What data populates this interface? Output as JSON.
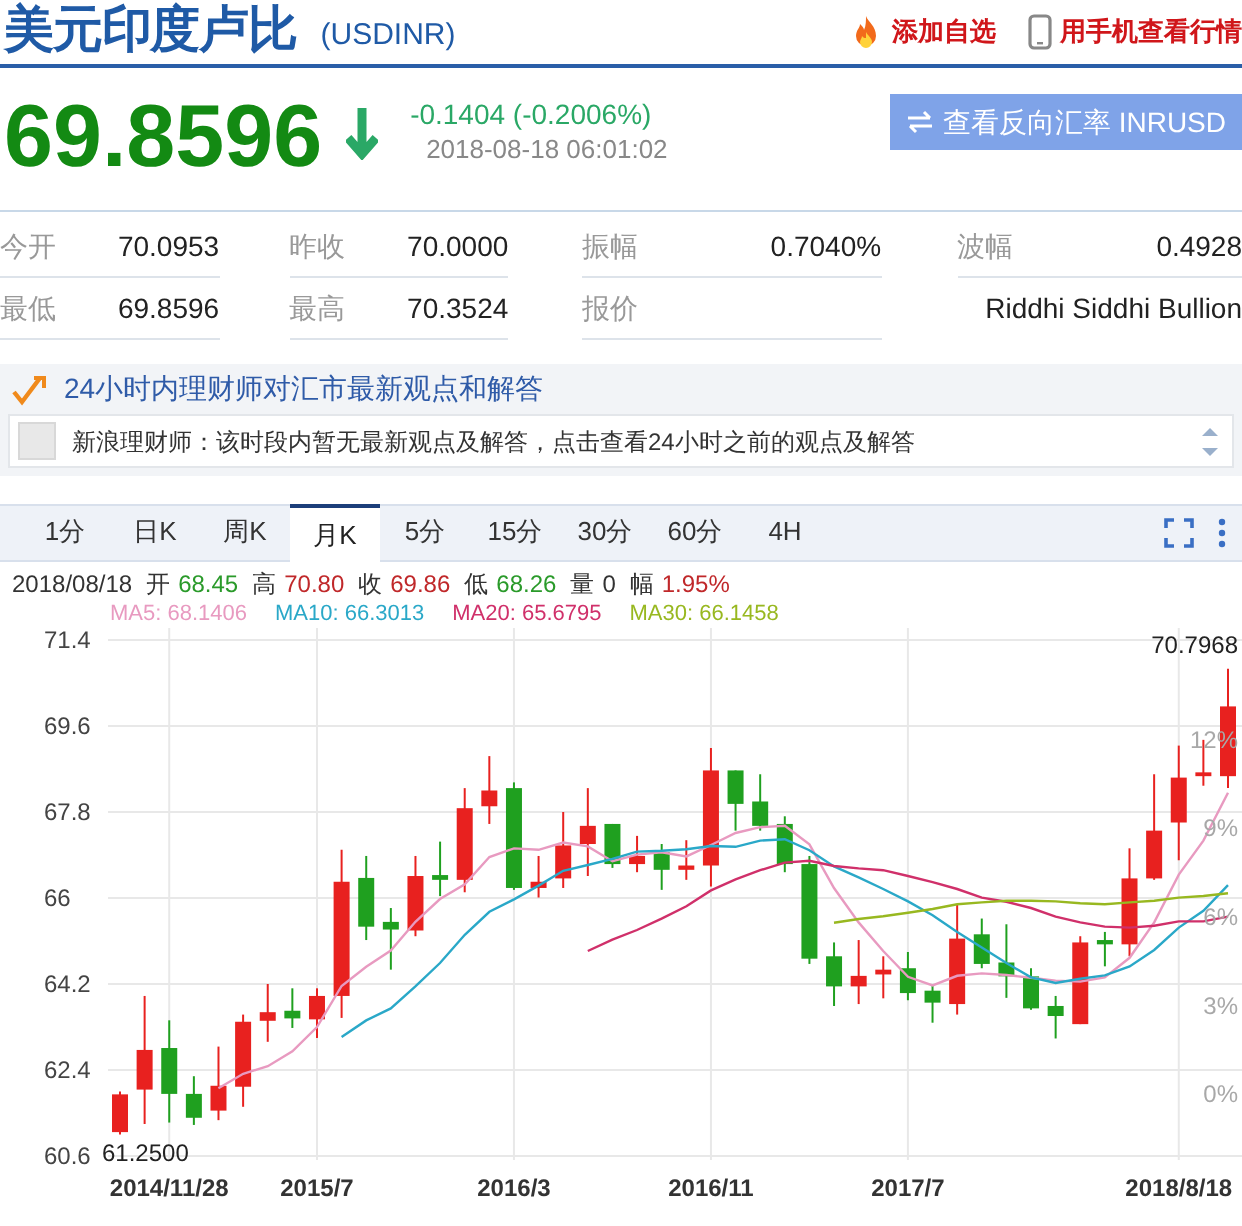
{
  "header": {
    "title": "美元印度卢比",
    "code": "(USDINR)",
    "actions": [
      {
        "kind": "favorite",
        "label": "添加自选"
      },
      {
        "kind": "mobile",
        "label": "用手机查看行情"
      }
    ]
  },
  "quote": {
    "price": "69.8596",
    "change": "-0.1404 (-0.2006%)",
    "time": "2018-08-18 06:01:02",
    "reverse_button": "查看反向汇率 INRUSD"
  },
  "stats": [
    [
      {
        "label": "今开",
        "value": "70.0953"
      },
      {
        "label": "昨收",
        "value": "70.0000"
      },
      {
        "label": "振幅",
        "value": "0.7040%"
      },
      {
        "label": "波幅",
        "value": "0.4928"
      }
    ],
    [
      {
        "label": "最低",
        "value": "69.8596"
      },
      {
        "label": "最高",
        "value": "70.3524"
      },
      {
        "label": "报价"
      },
      {
        "value": "Riddhi Siddhi Bullion"
      }
    ]
  ],
  "advice": {
    "title": "24小时内理财师对汇市最新观点和解答",
    "message": "新浪理财师：该时段内暂无最新观点及解答，点击查看24小时之前的观点及解答"
  },
  "tabs": [
    {
      "label": "1分",
      "selected": false
    },
    {
      "label": "日K",
      "selected": false
    },
    {
      "label": "周K",
      "selected": false
    },
    {
      "label": "月K",
      "selected": true
    },
    {
      "label": "5分",
      "selected": false
    },
    {
      "label": "15分",
      "selected": false
    },
    {
      "label": "30分",
      "selected": false
    },
    {
      "label": "60分",
      "selected": false
    },
    {
      "label": "4H",
      "selected": false
    }
  ],
  "summary": [
    {
      "kind": "date",
      "text": "2018/08/18"
    },
    {
      "kind": "label",
      "text": "开"
    },
    {
      "kind": "down",
      "text": "68.45"
    },
    {
      "kind": "label",
      "text": "高"
    },
    {
      "kind": "up",
      "text": "70.80"
    },
    {
      "kind": "label",
      "text": "收"
    },
    {
      "kind": "up",
      "text": "69.86"
    },
    {
      "kind": "label",
      "text": "低"
    },
    {
      "kind": "down",
      "text": "68.26"
    },
    {
      "kind": "label",
      "text": "量"
    },
    {
      "kind": "date",
      "text": "0"
    },
    {
      "kind": "label",
      "text": "幅"
    },
    {
      "kind": "up",
      "text": "1.95%"
    }
  ],
  "moving_average_values": [
    "68.1406",
    "66.3013",
    "65.6795",
    "66.1458"
  ],
  "percent_axis": [
    "12%",
    "9%",
    "6%",
    "3%",
    "0%"
  ],
  "chart_data": {
    "type": "candlestick",
    "grid": true,
    "ylim": [
      60.6,
      71.4
    ],
    "yticks": [
      71.4,
      69.6,
      67.8,
      66,
      64.2,
      62.4,
      60.6
    ],
    "categories": [
      null,
      null,
      "2014/11/28",
      null,
      null,
      null,
      null,
      null,
      "2015/7",
      null,
      null,
      null,
      null,
      null,
      null,
      null,
      "2016/3",
      null,
      null,
      null,
      null,
      null,
      null,
      null,
      "2016/11",
      null,
      null,
      null,
      null,
      null,
      null,
      null,
      "2017/7",
      null,
      null,
      null,
      null,
      null,
      null,
      null,
      null,
      null,
      null,
      "2018/8/18",
      null,
      null
    ],
    "series": [
      {
        "name": "MA5:",
        "type": "line",
        "color": "#e89ac0",
        "values": [
          null,
          null,
          null,
          null,
          62.02,
          62.32,
          62.48,
          62.79,
          63.3,
          64.16,
          64.56,
          64.9,
          65.5,
          65.98,
          66.29,
          66.86,
          67.04,
          67.01,
          67.16,
          67.08,
          66.77,
          66.91,
          66.96,
          66.87,
          67.11,
          67.36,
          67.48,
          67.51,
          67.12,
          66.21,
          65.49,
          64.89,
          64.35,
          64.17,
          64.37,
          64.42,
          64.39,
          64.33,
          64.27,
          64.25,
          64.34,
          64.75,
          65.49,
          66.49,
          67.2,
          68.2
        ]
      },
      {
        "name": "MA10:",
        "type": "line",
        "color": "#2aa8c8",
        "values": [
          null,
          null,
          null,
          null,
          null,
          null,
          null,
          null,
          null,
          63.09,
          63.44,
          63.69,
          64.15,
          64.64,
          65.23,
          65.71,
          65.97,
          66.26,
          66.57,
          66.69,
          66.82,
          66.97,
          66.99,
          67.02,
          67.09,
          67.07,
          67.2,
          67.23,
          67.0,
          66.66,
          66.43,
          66.19,
          65.93,
          65.64,
          65.29,
          64.96,
          64.64,
          64.34,
          64.22,
          64.31,
          64.38,
          64.57,
          64.91,
          65.38,
          65.73,
          66.27
        ]
      },
      {
        "name": "MA20:",
        "type": "line",
        "color": "#d0306a",
        "values": [
          null,
          null,
          null,
          null,
          null,
          null,
          null,
          null,
          null,
          null,
          null,
          null,
          null,
          null,
          null,
          null,
          null,
          null,
          null,
          64.89,
          65.13,
          65.33,
          65.57,
          65.83,
          66.16,
          66.39,
          66.58,
          66.74,
          66.78,
          66.67,
          66.62,
          66.58,
          66.46,
          66.33,
          66.19,
          66.01,
          65.92,
          65.79,
          65.61,
          65.49,
          65.4,
          65.38,
          65.42,
          65.51,
          65.51,
          65.61
        ]
      },
      {
        "name": "MA30:",
        "type": "line",
        "color": "#98b820",
        "values": [
          null,
          null,
          null,
          null,
          null,
          null,
          null,
          null,
          null,
          null,
          null,
          null,
          null,
          null,
          null,
          null,
          null,
          null,
          null,
          null,
          null,
          null,
          null,
          null,
          null,
          null,
          null,
          null,
          null,
          65.48,
          65.56,
          65.62,
          65.69,
          65.77,
          65.87,
          65.91,
          65.94,
          65.94,
          65.93,
          65.89,
          65.87,
          65.91,
          65.94,
          66.01,
          66.04,
          66.1
        ]
      }
    ],
    "annotations": [
      "70.7968",
      "61.2500"
    ],
    "ohlc": [
      [
        61.1,
        61.95,
        61.05,
        61.89
      ],
      [
        61.99,
        63.95,
        61.27,
        62.82
      ],
      [
        62.86,
        63.44,
        61.3,
        61.9
      ],
      [
        61.9,
        62.27,
        61.25,
        61.4
      ],
      [
        61.55,
        62.89,
        61.35,
        62.07
      ],
      [
        62.05,
        63.56,
        61.63,
        63.41
      ],
      [
        63.43,
        64.2,
        62.99,
        63.61
      ],
      [
        63.64,
        64.11,
        63.28,
        63.48
      ],
      [
        63.46,
        64.11,
        63.07,
        63.95
      ],
      [
        63.95,
        67.01,
        63.49,
        66.34
      ],
      [
        66.42,
        66.88,
        65.12,
        65.4
      ],
      [
        65.5,
        65.79,
        64.5,
        65.34
      ],
      [
        65.32,
        66.88,
        65.2,
        66.46
      ],
      [
        66.48,
        67.18,
        66.04,
        66.38
      ],
      [
        66.38,
        68.3,
        66.12,
        67.88
      ],
      [
        67.92,
        68.97,
        67.55,
        68.25
      ],
      [
        68.3,
        68.42,
        66.17,
        66.21
      ],
      [
        66.21,
        66.88,
        66.01,
        66.34
      ],
      [
        66.41,
        67.8,
        66.21,
        67.1
      ],
      [
        67.13,
        68.3,
        66.46,
        67.51
      ],
      [
        67.55,
        67.55,
        66.63,
        66.71
      ],
      [
        66.71,
        67.3,
        66.54,
        66.88
      ],
      [
        66.96,
        67.13,
        66.17,
        66.59
      ],
      [
        66.59,
        67.21,
        66.38,
        66.68
      ],
      [
        66.68,
        69.14,
        66.24,
        68.67
      ],
      [
        68.67,
        68.67,
        67.41,
        67.97
      ],
      [
        68.02,
        68.59,
        67.41,
        67.51
      ],
      [
        67.55,
        67.71,
        66.54,
        66.71
      ],
      [
        66.71,
        66.88,
        64.62,
        64.73
      ],
      [
        64.78,
        65.07,
        63.74,
        64.15
      ],
      [
        64.15,
        65.12,
        63.78,
        64.37
      ],
      [
        64.4,
        64.78,
        63.9,
        64.5
      ],
      [
        64.53,
        64.87,
        63.86,
        64.01
      ],
      [
        64.06,
        64.2,
        63.39,
        63.81
      ],
      [
        63.78,
        65.87,
        63.56,
        65.15
      ],
      [
        65.24,
        65.57,
        64.53,
        64.62
      ],
      [
        64.65,
        65.45,
        63.91,
        64.36
      ],
      [
        64.36,
        64.53,
        63.66,
        63.69
      ],
      [
        63.74,
        63.95,
        63.06,
        63.53
      ],
      [
        63.36,
        65.2,
        63.36,
        65.07
      ],
      [
        65.12,
        65.29,
        64.57,
        65.03
      ],
      [
        65.03,
        67.04,
        64.78,
        66.41
      ],
      [
        66.41,
        68.59,
        66.38,
        67.41
      ],
      [
        67.58,
        69.19,
        66.79,
        68.52
      ],
      [
        68.55,
        69.31,
        68.35,
        68.63
      ],
      [
        68.55,
        70.8,
        68.3,
        70.01
      ]
    ]
  }
}
